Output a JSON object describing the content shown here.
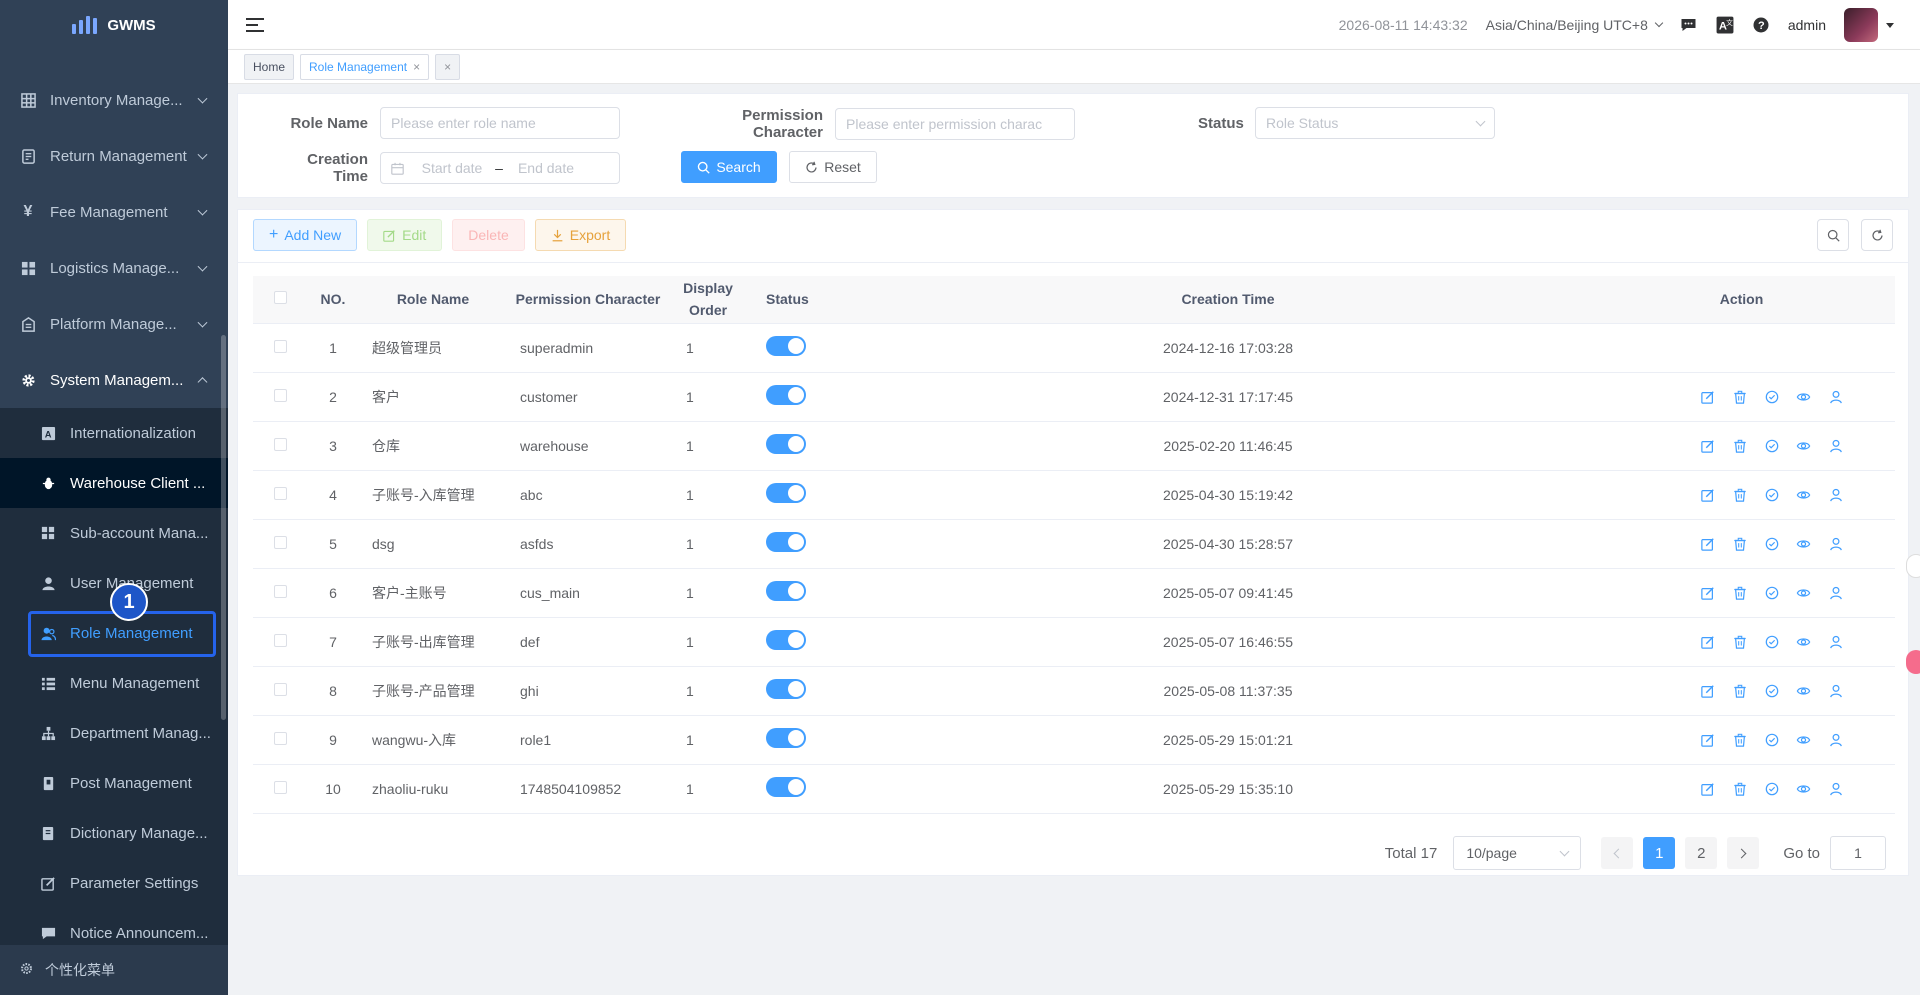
{
  "app": {
    "name": "GWMS"
  },
  "sidebar": {
    "menus": [
      {
        "label": "Inventory Manage...",
        "icon": "grid-icon"
      },
      {
        "label": "Return Management",
        "icon": "return-icon"
      },
      {
        "label": "Fee Management",
        "icon": "yen-icon"
      },
      {
        "label": "Logistics Manage...",
        "icon": "apps-icon"
      },
      {
        "label": "Platform Manage...",
        "icon": "building-icon"
      },
      {
        "label": "System Managem...",
        "icon": "gear-icon"
      }
    ],
    "submenu": [
      {
        "label": "Internationalization",
        "icon": "translate-icon"
      },
      {
        "label": "Warehouse Client ...",
        "icon": "bug-icon"
      },
      {
        "label": "Sub-account Mana...",
        "icon": "apps-icon"
      },
      {
        "label": "User Management",
        "icon": "user-icon"
      },
      {
        "label": "Role Management",
        "icon": "users-icon"
      },
      {
        "label": "Menu Management",
        "icon": "list-icon"
      },
      {
        "label": "Department Manag...",
        "icon": "tree-icon"
      },
      {
        "label": "Post Management",
        "icon": "post-icon"
      },
      {
        "label": "Dictionary Manage...",
        "icon": "book-icon"
      },
      {
        "label": "Parameter Settings",
        "icon": "edit-icon"
      },
      {
        "label": "Notice Announcem...",
        "icon": "message-icon"
      }
    ],
    "footer_label": "个性化菜单",
    "step_badge": "1"
  },
  "header": {
    "datetime": "2026-08-11 14:43:32",
    "timezone": "Asia/China/Beijing UTC+8",
    "username": "admin"
  },
  "tags": {
    "home": "Home",
    "active": "Role Management",
    "close": "×"
  },
  "search": {
    "role_name_label": "Role Name",
    "role_name_placeholder": "Please enter role name",
    "perm_label": "Permission Character",
    "perm_placeholder": "Please enter permission charac",
    "status_label": "Status",
    "status_placeholder": "Role Status",
    "time_label": "Creation Time",
    "start_placeholder": "Start date",
    "range_sep": "–",
    "end_placeholder": "End date",
    "search_btn": "Search",
    "reset_btn": "Reset"
  },
  "toolbar": {
    "add": "Add New",
    "edit": "Edit",
    "delete": "Delete",
    "export": "Export"
  },
  "table": {
    "headers": {
      "no": "NO.",
      "role_name": "Role Name",
      "perm": "Permission Character",
      "display_order_1": "Display",
      "display_order_2": "Order",
      "status": "Status",
      "creation_time": "Creation Time",
      "action": "Action"
    },
    "rows": [
      {
        "no": "1",
        "name": "超级管理员",
        "perm": "superadmin",
        "order": "1",
        "time": "2024-12-16 17:03:28",
        "actions": false
      },
      {
        "no": "2",
        "name": "客户",
        "perm": "customer",
        "order": "1",
        "time": "2024-12-31 17:17:45",
        "actions": true
      },
      {
        "no": "3",
        "name": "仓库",
        "perm": "warehouse",
        "order": "1",
        "time": "2025-02-20 11:46:45",
        "actions": true
      },
      {
        "no": "4",
        "name": "子账号-入库管理",
        "perm": "abc",
        "order": "1",
        "time": "2025-04-30 15:19:42",
        "actions": true
      },
      {
        "no": "5",
        "name": "dsg",
        "perm": "asfds",
        "order": "1",
        "time": "2025-04-30 15:28:57",
        "actions": true
      },
      {
        "no": "6",
        "name": "客户-主账号",
        "perm": "cus_main",
        "order": "1",
        "time": "2025-05-07 09:41:45",
        "actions": true
      },
      {
        "no": "7",
        "name": "子账号-出库管理",
        "perm": "def",
        "order": "1",
        "time": "2025-05-07 16:46:55",
        "actions": true
      },
      {
        "no": "8",
        "name": "子账号-产品管理",
        "perm": "ghi",
        "order": "1",
        "time": "2025-05-08 11:37:35",
        "actions": true
      },
      {
        "no": "9",
        "name": "wangwu-入库",
        "perm": "role1",
        "order": "1",
        "time": "2025-05-29 15:01:21",
        "actions": true
      },
      {
        "no": "10",
        "name": "zhaoliu-ruku",
        "perm": "1748504109852",
        "order": "1",
        "time": "2025-05-29 15:35:10",
        "actions": true
      }
    ]
  },
  "pagination": {
    "total": "Total 17",
    "page_size": "10/page",
    "page1": "1",
    "page2": "2",
    "goto_label": "Go to",
    "goto_value": "1"
  },
  "colors": {
    "primary": "#409eff",
    "sidebar_bg": "#304156",
    "highlight": "#2563eb"
  }
}
